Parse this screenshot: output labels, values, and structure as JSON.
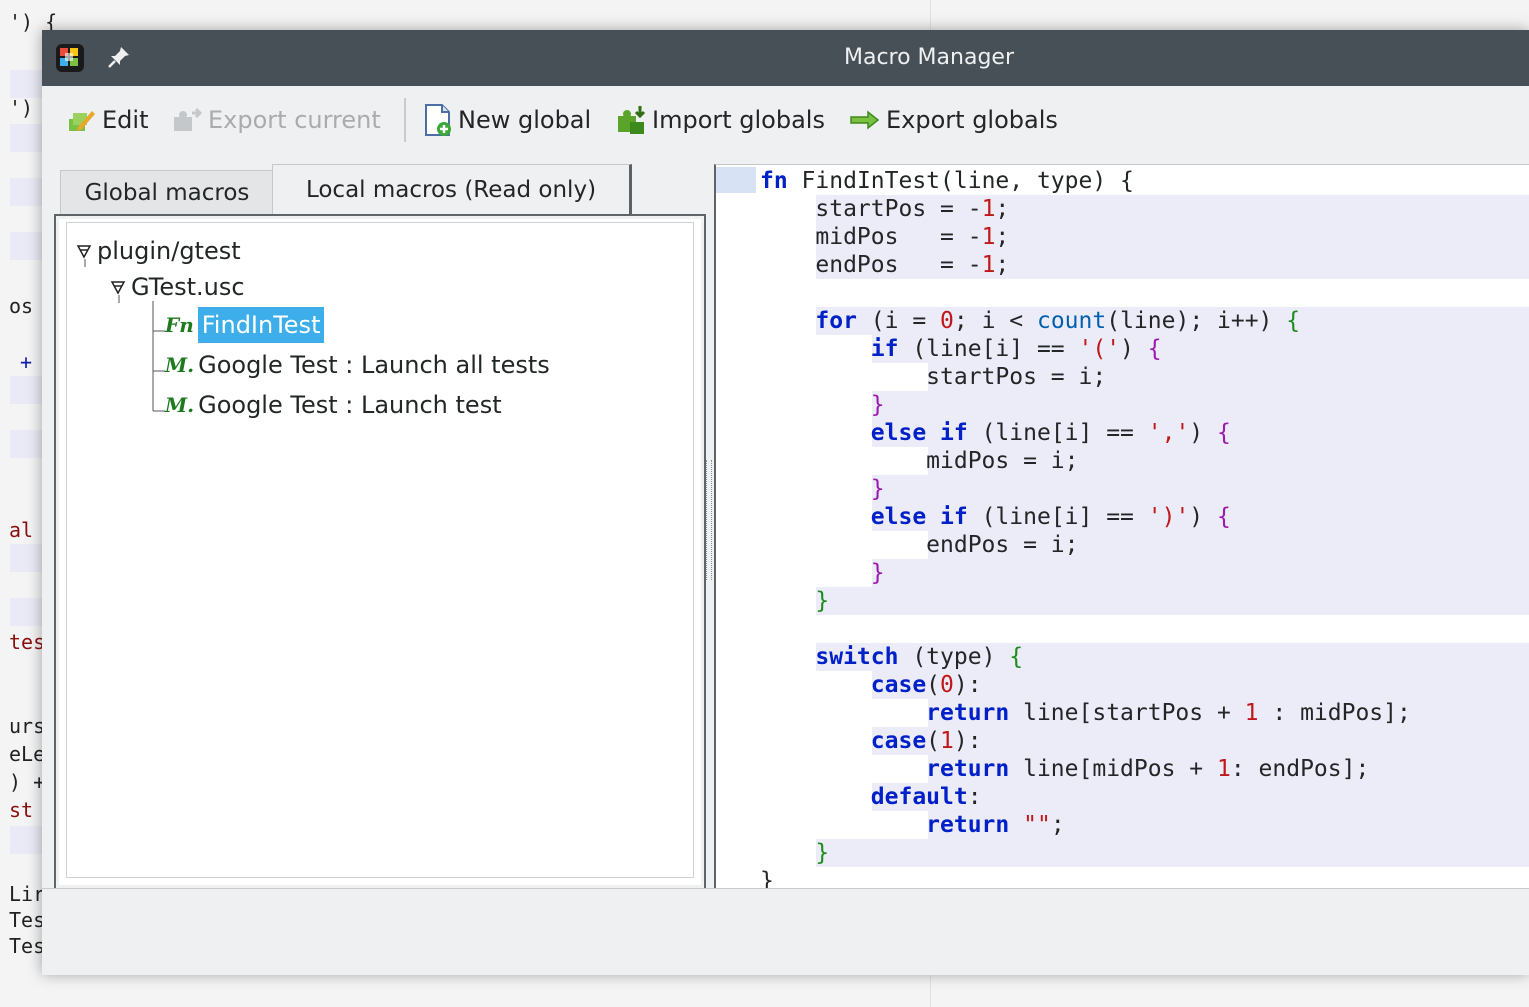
{
  "window": {
    "title": "Macro Manager"
  },
  "toolbar": {
    "edit": "Edit",
    "export_current": "Export current",
    "new_global": "New global",
    "import_globals": "Import globals",
    "export_globals": "Export globals"
  },
  "tabs": [
    {
      "label": "Global macros",
      "active": false
    },
    {
      "label": "Local macros (Read only)",
      "active": true
    }
  ],
  "tree": {
    "root": "plugin/gtest",
    "file": "GTest.usc",
    "items": [
      {
        "icon": "Fn",
        "label": "FindInTest",
        "selected": true
      },
      {
        "icon": "M.",
        "label": "Google Test : Launch all tests",
        "selected": false
      },
      {
        "icon": "M.",
        "label": "Google Test : Launch test",
        "selected": false
      }
    ]
  },
  "code": {
    "lines": [
      "fn FindInTest(line, type) {",
      "    startPos = -1;",
      "    midPos   = -1;",
      "    endPos   = -1;",
      "",
      "    for (i = 0; i < count(line); i++) {",
      "        if (line[i] == '(') {",
      "            startPos = i;",
      "        }",
      "        else if (line[i] == ',') {",
      "            midPos = i;",
      "        }",
      "        else if (line[i] == ')') {",
      "            endPos = i;",
      "        }",
      "    }",
      "",
      "    switch (type) {",
      "        case(0):",
      "            return line[startPos + 1 : midPos];",
      "        case(1):",
      "            return line[midPos + 1: endPos];",
      "        default:",
      "            return \"\";",
      "    }",
      "}"
    ]
  },
  "background_fragments": [
    "') {",
    "')",
    "os",
    "+",
    "al",
    "tes",
    "urs",
    "eLe",
    ") +",
    "st",
    "Lir",
    "Tes",
    "Tes"
  ],
  "colors": {
    "titlebar": "#475057",
    "selection": "#3daee9",
    "keyword": "#0020c8"
  }
}
